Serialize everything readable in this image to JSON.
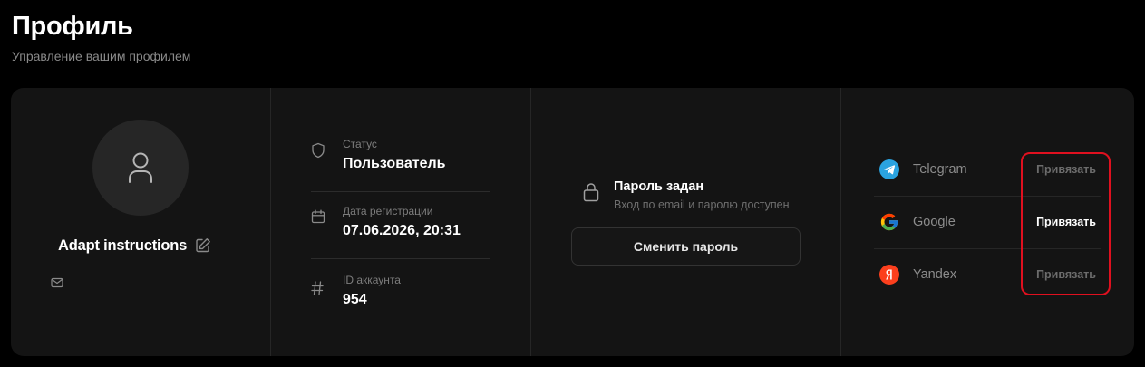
{
  "header": {
    "title": "Профиль",
    "subtitle": "Управление вашим профилем"
  },
  "profile": {
    "avatar_icon": "user-icon",
    "username": "Adapt instructions",
    "edit_icon": "edit-icon",
    "email_icon": "mail-icon"
  },
  "info": {
    "status_label": "Статус",
    "status_value": "Пользователь",
    "reg_label": "Дата регистрации",
    "reg_value": "07.06.2026, 20:31",
    "id_label": "ID аккаунта",
    "id_value": "954"
  },
  "password": {
    "title": "Пароль задан",
    "description": "Вход по email и паролю доступен",
    "change_button": "Сменить пароль"
  },
  "links": {
    "items": [
      {
        "name": "Telegram",
        "icon": "telegram-icon",
        "action": "Привязать"
      },
      {
        "name": "Google",
        "icon": "google-icon",
        "action": "Привязать"
      },
      {
        "name": "Yandex",
        "icon": "yandex-icon",
        "action": "Привязать"
      }
    ]
  },
  "colors": {
    "background": "#000000",
    "card": "#141414",
    "highlight": "#e0101f",
    "telegram": "#2aa3e0",
    "yandex": "#fc3f1d"
  }
}
